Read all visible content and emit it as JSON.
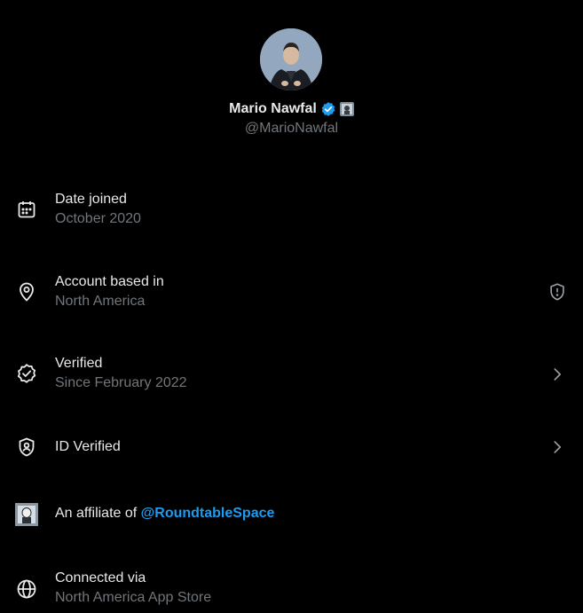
{
  "profile": {
    "name": "Mario Nawfal",
    "handle": "@MarioNawfal",
    "verified_color": "#1d9bf0"
  },
  "rows": {
    "date_joined": {
      "title": "Date joined",
      "value": "October 2020",
      "icon": "calendar-icon"
    },
    "account_based": {
      "title": "Account based in",
      "value": "North America",
      "icon": "location-pin-icon",
      "right_icon": "shield-alert-icon"
    },
    "verified": {
      "title": "Verified",
      "value": "Since February 2022",
      "icon": "verified-check-icon",
      "right_icon": "chevron-right-icon"
    },
    "id_verified": {
      "title": "ID Verified",
      "icon": "id-shield-icon",
      "right_icon": "chevron-right-icon"
    },
    "affiliate": {
      "prefix": "An affiliate of ",
      "link": "@RoundtableSpace",
      "icon": "affiliate-avatar-icon"
    },
    "connected": {
      "title": "Connected via",
      "value": "North America App Store",
      "icon": "globe-icon"
    }
  },
  "colors": {
    "background": "#000000",
    "primary_text": "#e7e9ea",
    "secondary_text": "#71767b",
    "link": "#1d9bf0"
  }
}
